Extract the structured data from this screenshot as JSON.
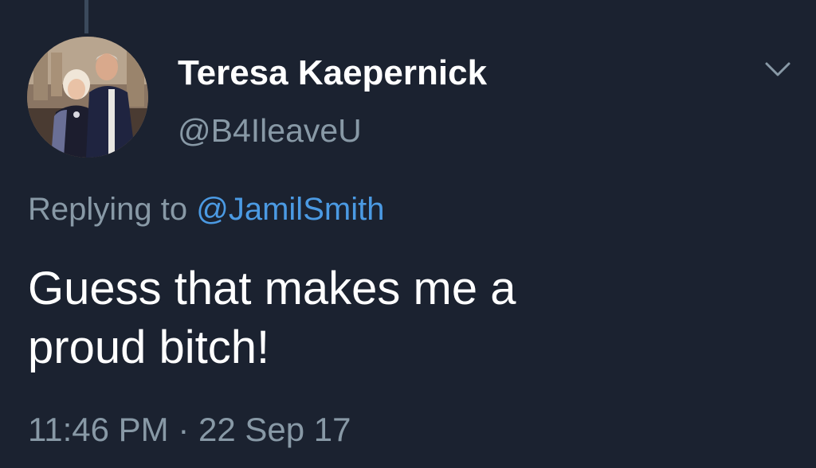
{
  "tweet": {
    "author": {
      "display_name": "Teresa Kaepernick",
      "handle": "@B4IleaveU"
    },
    "reply": {
      "prefix": "Replying to",
      "mention": "@JamilSmith"
    },
    "text_lines": [
      "Guess that makes me a",
      "proud bitch!"
    ],
    "timestamp": "11:46 PM · 22 Sep 17"
  },
  "icons": {
    "menu": "chevron-down-icon",
    "avatar": "profile-photo"
  },
  "colors": {
    "background": "#1b2230",
    "primary_text": "#ffffff",
    "secondary_text": "#8899a6",
    "link": "#4b9ae3",
    "thread_line": "#3b4a5c"
  }
}
